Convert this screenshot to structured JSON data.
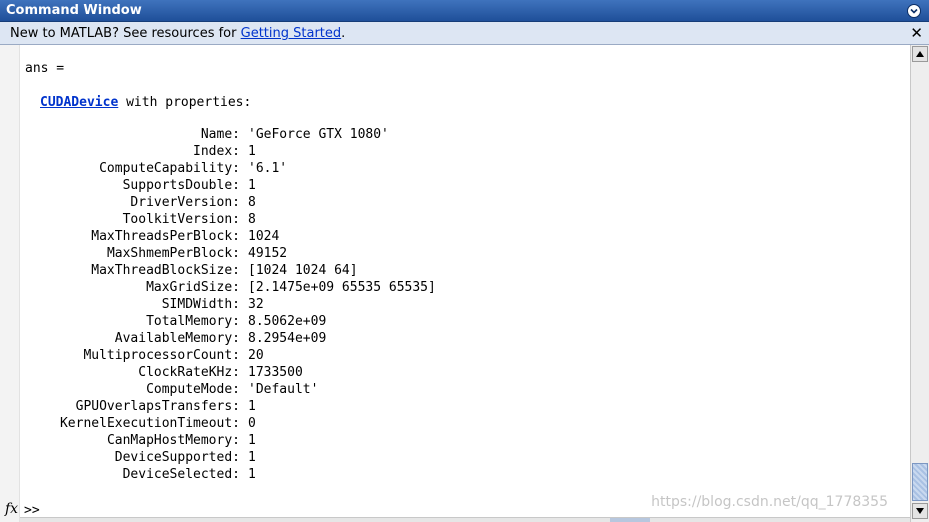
{
  "window": {
    "title": "Command Window",
    "menu_icon": "chevron-down-circle-icon"
  },
  "infobar": {
    "message_prefix": "New to MATLAB? See resources for ",
    "link_text": "Getting Started",
    "message_suffix": ".",
    "close_symbol": "✕"
  },
  "output": {
    "ans_line": "ans =",
    "class_link": "CUDADevice",
    "class_suffix": " with properties:",
    "properties": [
      {
        "name": "Name:",
        "value": "'GeForce GTX 1080'"
      },
      {
        "name": "Index:",
        "value": "1"
      },
      {
        "name": "ComputeCapability:",
        "value": "'6.1'"
      },
      {
        "name": "SupportsDouble:",
        "value": "1"
      },
      {
        "name": "DriverVersion:",
        "value": "8"
      },
      {
        "name": "ToolkitVersion:",
        "value": "8"
      },
      {
        "name": "MaxThreadsPerBlock:",
        "value": "1024"
      },
      {
        "name": "MaxShmemPerBlock:",
        "value": "49152"
      },
      {
        "name": "MaxThreadBlockSize:",
        "value": "[1024 1024 64]"
      },
      {
        "name": "MaxGridSize:",
        "value": "[2.1475e+09 65535 65535]"
      },
      {
        "name": "SIMDWidth:",
        "value": "32"
      },
      {
        "name": "TotalMemory:",
        "value": "8.5062e+09"
      },
      {
        "name": "AvailableMemory:",
        "value": "8.2954e+09"
      },
      {
        "name": "MultiprocessorCount:",
        "value": "20"
      },
      {
        "name": "ClockRateKHz:",
        "value": "1733500"
      },
      {
        "name": "ComputeMode:",
        "value": "'Default'"
      },
      {
        "name": "GPUOverlapsTransfers:",
        "value": "1"
      },
      {
        "name": "KernelExecutionTimeout:",
        "value": "0"
      },
      {
        "name": "CanMapHostMemory:",
        "value": "1"
      },
      {
        "name": "DeviceSupported:",
        "value": "1"
      },
      {
        "name": "DeviceSelected:",
        "value": "1"
      }
    ]
  },
  "prompt": {
    "fx_label": "fx",
    "symbol": ">>"
  },
  "watermark": "https://blog.csdn.net/qq_1778355"
}
